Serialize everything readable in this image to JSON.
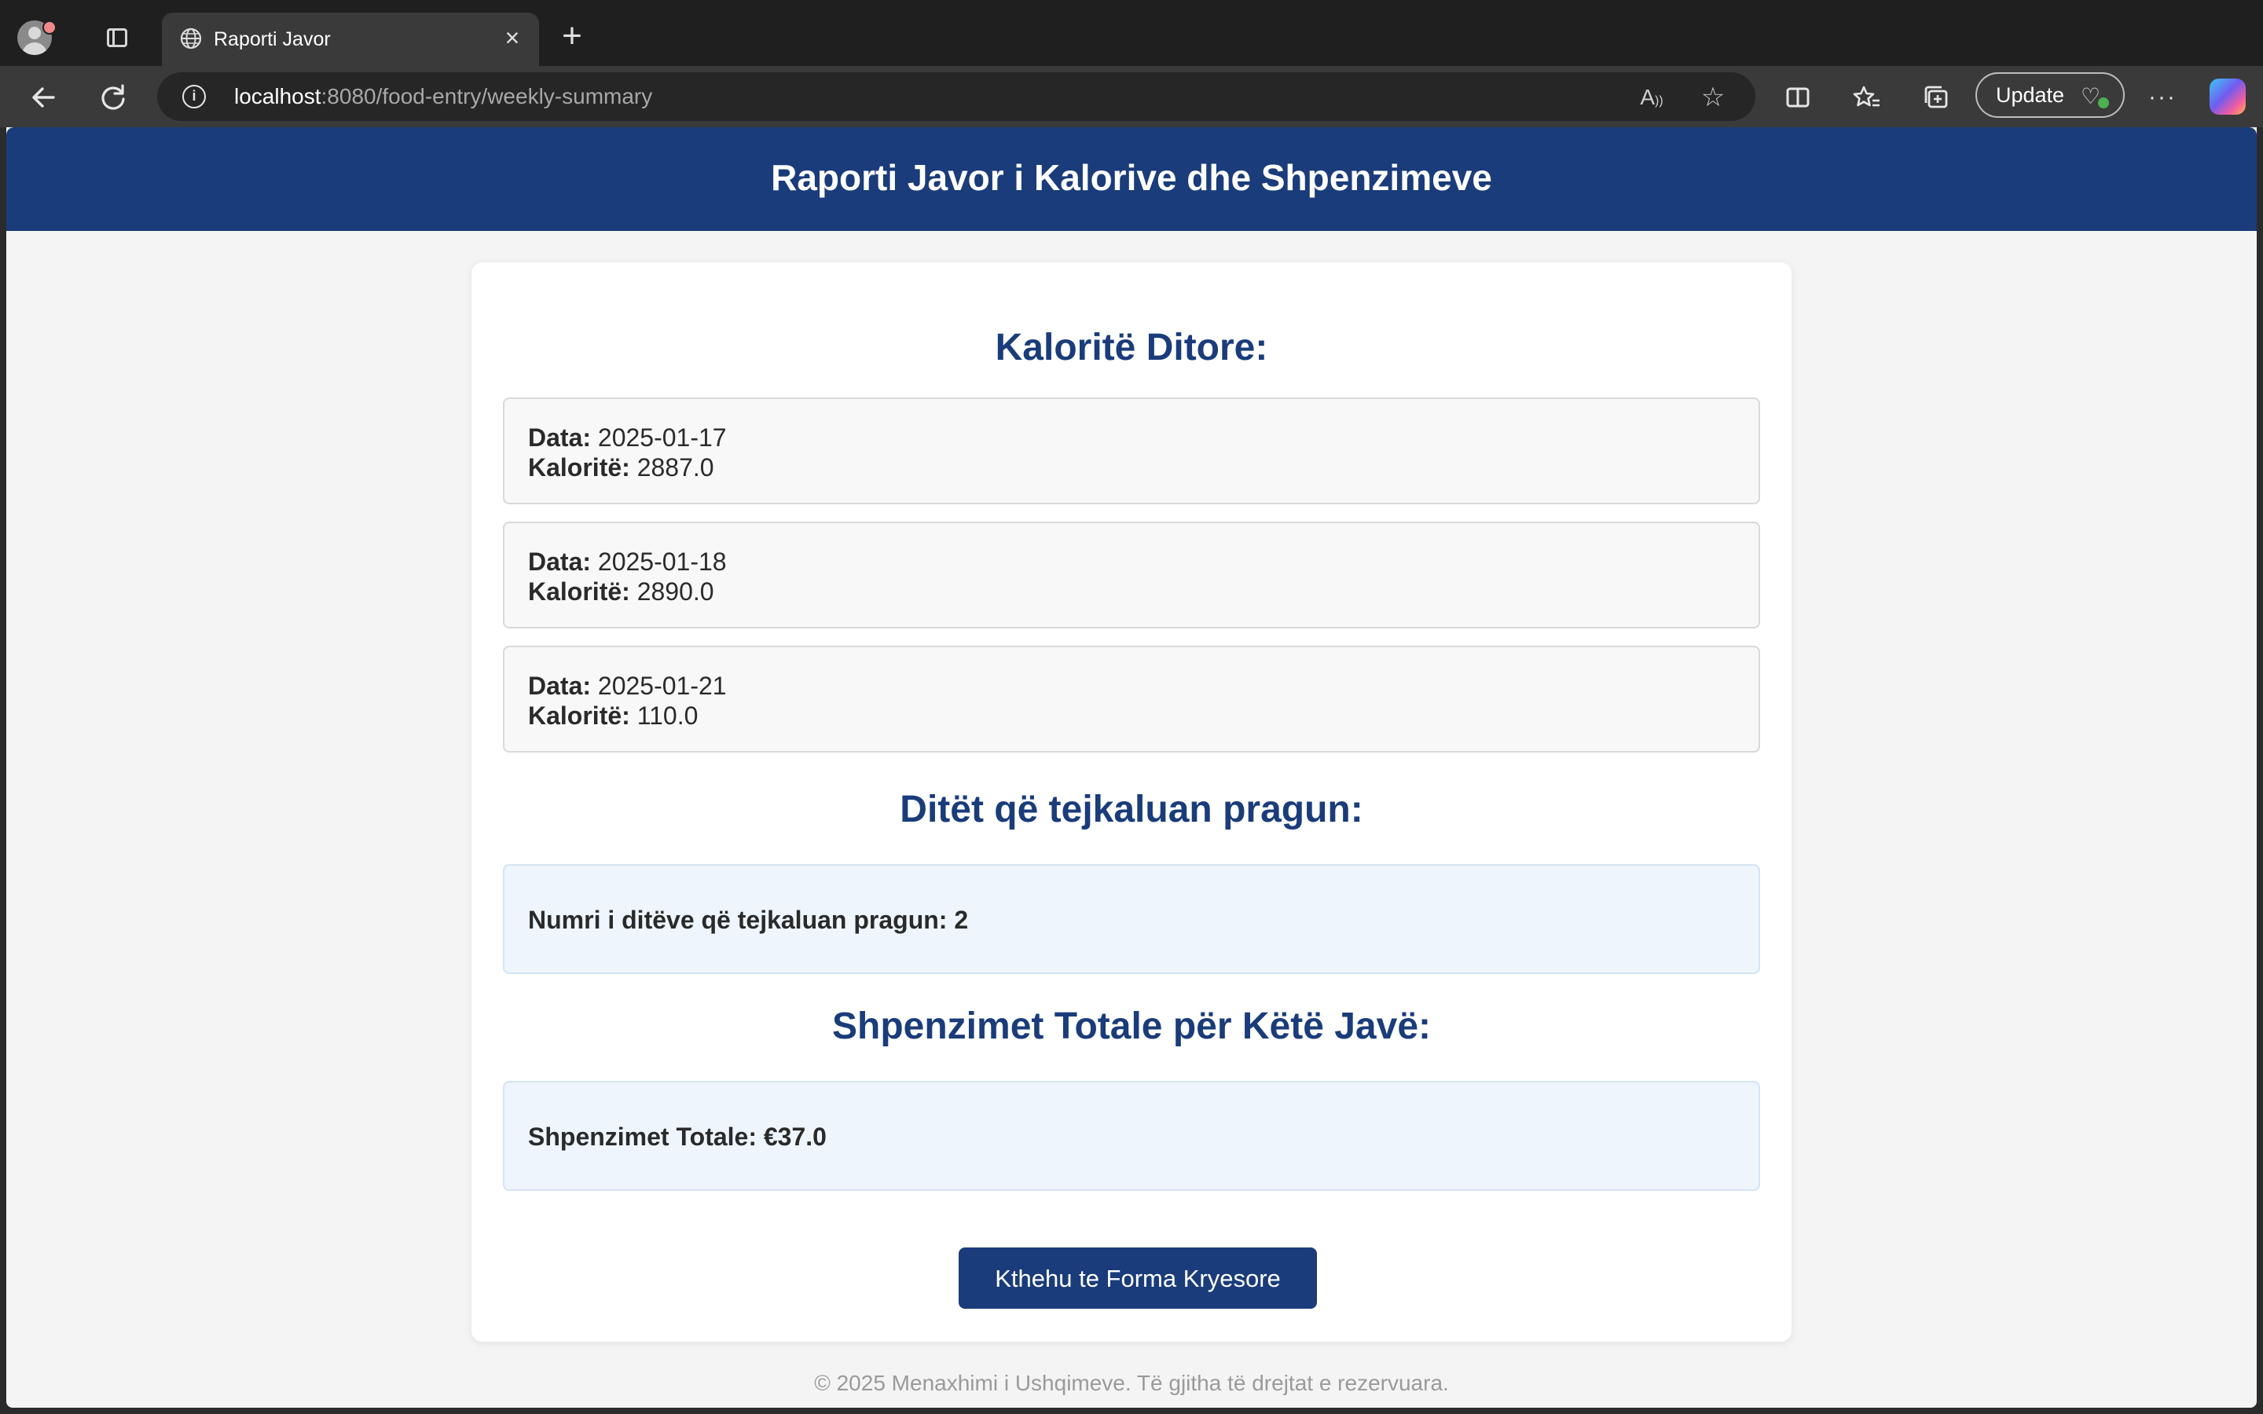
{
  "browser": {
    "tab_title": "Raporti Javor",
    "url_host": "localhost",
    "url_rest": ":8080/food-entry/weekly-summary",
    "update_label": "Update"
  },
  "page": {
    "header_title": "Raporti Javor i Kalorive dhe Shpenzimeve",
    "daily_title": "Kaloritë Ditore:",
    "date_label": "Data:",
    "calories_label": "Kaloritë:",
    "days": [
      {
        "date": "2025-01-17",
        "calories": "2887.0"
      },
      {
        "date": "2025-01-18",
        "calories": "2890.0"
      },
      {
        "date": "2025-01-21",
        "calories": "110.0"
      }
    ],
    "threshold_title": "Ditët që tejkaluan pragun:",
    "threshold_text": "Numri i ditëve që tejkaluan pragun: 2",
    "expenses_title": "Shpenzimet Totale për Këtë Javë:",
    "expenses_text": "Shpenzimet Totale: €37.0",
    "back_button": "Kthehu te Forma Kryesore",
    "footer": "© 2025 Menaxhimi i Ushqimeve. Të gjitha të drejtat e rezervuara."
  },
  "colors": {
    "header_bg": "#1a3c7a",
    "accent": "#1a3c7a",
    "info_box_bg": "#eef5fd"
  }
}
